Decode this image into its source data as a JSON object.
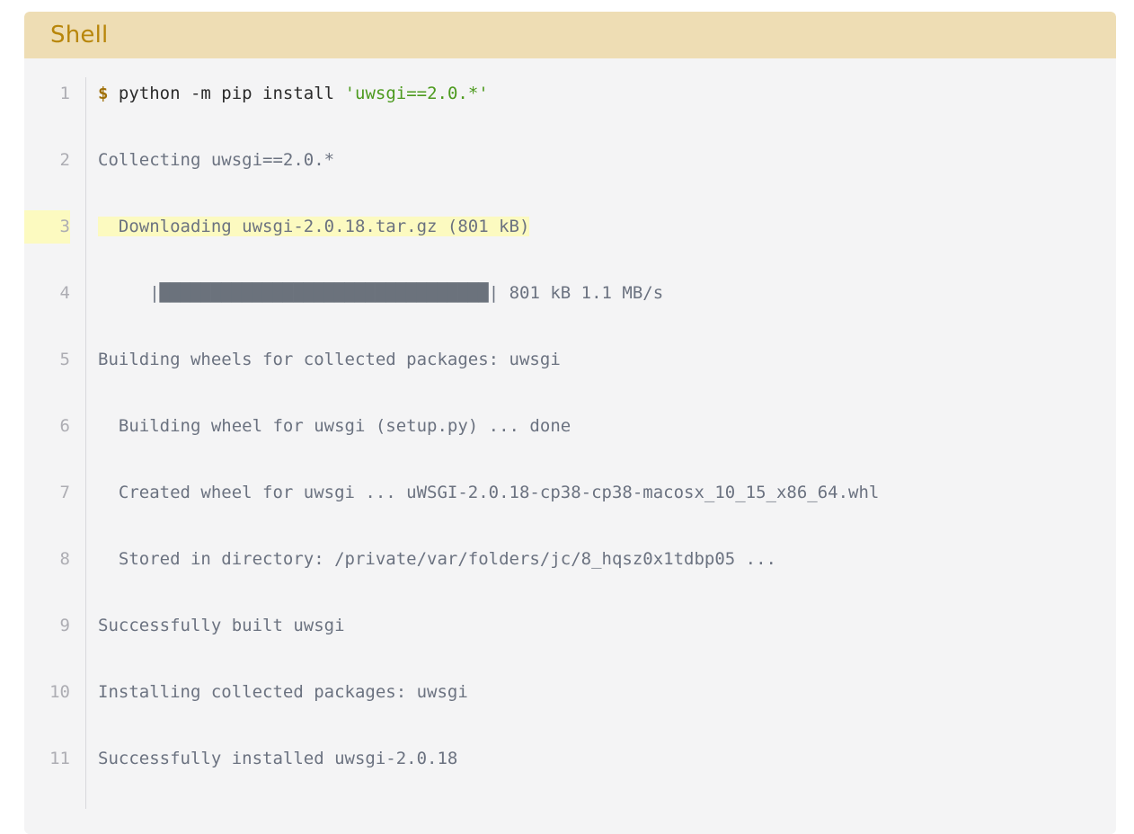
{
  "block": {
    "caption": "Shell",
    "language": "shell",
    "colors": {
      "caption_background": "#eeddb4",
      "caption_text": "#b8860b",
      "code_background": "#f4f4f5",
      "highlight_background": "#fcfac0",
      "linenumber_text": "#adadb3",
      "output_text": "#6b7280",
      "prompt_text": "#a0700a",
      "command_text": "#2b2b2b",
      "string_text": "#4c9a1e",
      "progressbar_fill": "#6b727c",
      "gutter_divider": "#d8d8dc"
    },
    "highlighted_lines": [
      3
    ],
    "line_numbers": [
      "1",
      "2",
      "3",
      "4",
      "5",
      "6",
      "7",
      "8",
      "9",
      "10",
      "11"
    ],
    "lines": [
      {
        "n": "1",
        "highlight": false,
        "text": "$ python -m pip install 'uwsgi==2.0.*'",
        "tokens": [
          {
            "kind": "prompt",
            "text": "$"
          },
          {
            "kind": "command",
            "text": " python -m pip install "
          },
          {
            "kind": "string",
            "text": "'uwsgi==2.0.*'"
          }
        ]
      },
      {
        "n": "2",
        "highlight": false,
        "text": "Collecting uwsgi==2.0.*",
        "tokens": [
          {
            "kind": "output",
            "text": "Collecting uwsgi==2.0.*"
          }
        ]
      },
      {
        "n": "3",
        "highlight": true,
        "text": "  Downloading uwsgi-2.0.18.tar.gz (801 kB)",
        "tokens": [
          {
            "kind": "output",
            "text": "  Downloading uwsgi-2.0.18.tar.gz (801 kB)"
          }
        ]
      },
      {
        "n": "4",
        "highlight": false,
        "text": "     |████████████████████████████████| 801 kB 1.1 MB/s",
        "tokens": [
          {
            "kind": "output",
            "text": "     |"
          },
          {
            "kind": "bar",
            "text": "████████████████████████████████"
          },
          {
            "kind": "output",
            "text": "| 801 kB 1.1 MB/s"
          }
        ]
      },
      {
        "n": "5",
        "highlight": false,
        "text": "Building wheels for collected packages: uwsgi",
        "tokens": [
          {
            "kind": "output",
            "text": "Building wheels for collected packages: uwsgi"
          }
        ]
      },
      {
        "n": "6",
        "highlight": false,
        "text": "  Building wheel for uwsgi (setup.py) ... done",
        "tokens": [
          {
            "kind": "output",
            "text": "  Building wheel for uwsgi (setup.py) ... done"
          }
        ]
      },
      {
        "n": "7",
        "highlight": false,
        "text": "  Created wheel for uwsgi ... uWSGI-2.0.18-cp38-cp38-macosx_10_15_x86_64.whl",
        "tokens": [
          {
            "kind": "output",
            "text": "  Created wheel for uwsgi ... uWSGI-2.0.18-cp38-cp38-macosx_10_15_x86_64.whl"
          }
        ]
      },
      {
        "n": "8",
        "highlight": false,
        "text": "  Stored in directory: /private/var/folders/jc/8_hqsz0x1tdbp05 ...",
        "tokens": [
          {
            "kind": "output",
            "text": "  Stored in directory: /private/var/folders/jc/8_hqsz0x1tdbp05 ..."
          }
        ]
      },
      {
        "n": "9",
        "highlight": false,
        "text": "Successfully built uwsgi",
        "tokens": [
          {
            "kind": "output",
            "text": "Successfully built uwsgi"
          }
        ]
      },
      {
        "n": "10",
        "highlight": false,
        "text": "Installing collected packages: uwsgi",
        "tokens": [
          {
            "kind": "output",
            "text": "Installing collected packages: uwsgi"
          }
        ]
      },
      {
        "n": "11",
        "highlight": false,
        "text": "Successfully installed uwsgi-2.0.18",
        "tokens": [
          {
            "kind": "output",
            "text": "Successfully installed uwsgi-2.0.18"
          }
        ]
      }
    ]
  }
}
